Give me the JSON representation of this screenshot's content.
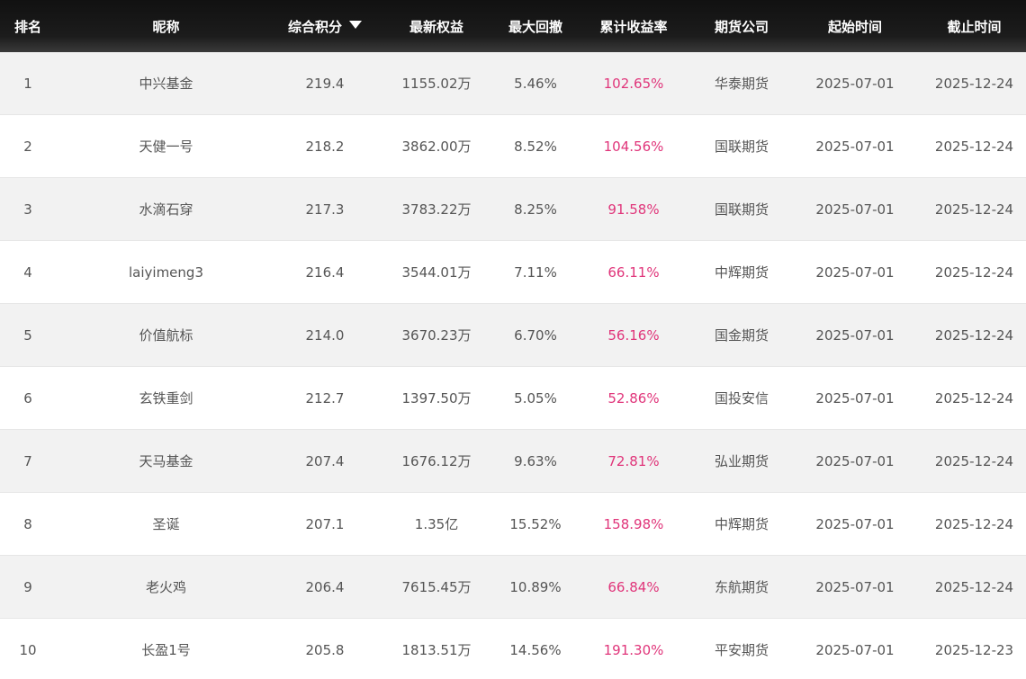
{
  "headers": {
    "rank": "排名",
    "nickname": "昵称",
    "score": "综合积分",
    "equity": "最新权益",
    "drawdown": "最大回撤",
    "return": "累计收益率",
    "company": "期货公司",
    "start": "起始时间",
    "end": "截止时间"
  },
  "sort": {
    "column": "score",
    "direction": "desc",
    "icon": "sort-down-icon"
  },
  "colors": {
    "header_bg": "#111111",
    "return_text": "#e0357a",
    "row_alt": "#f2f2f2"
  },
  "rows": [
    {
      "rank": "1",
      "nickname": "中兴基金",
      "score": "219.4",
      "equity": "1155.02万",
      "drawdown": "5.46%",
      "return": "102.65%",
      "company": "华泰期货",
      "start": "2025-07-01",
      "end": "2025-12-24"
    },
    {
      "rank": "2",
      "nickname": "天健一号",
      "score": "218.2",
      "equity": "3862.00万",
      "drawdown": "8.52%",
      "return": "104.56%",
      "company": "国联期货",
      "start": "2025-07-01",
      "end": "2025-12-24"
    },
    {
      "rank": "3",
      "nickname": "水滴石穿",
      "score": "217.3",
      "equity": "3783.22万",
      "drawdown": "8.25%",
      "return": "91.58%",
      "company": "国联期货",
      "start": "2025-07-01",
      "end": "2025-12-24"
    },
    {
      "rank": "4",
      "nickname": "laiyimeng3",
      "score": "216.4",
      "equity": "3544.01万",
      "drawdown": "7.11%",
      "return": "66.11%",
      "company": "中辉期货",
      "start": "2025-07-01",
      "end": "2025-12-24"
    },
    {
      "rank": "5",
      "nickname": "价值航标",
      "score": "214.0",
      "equity": "3670.23万",
      "drawdown": "6.70%",
      "return": "56.16%",
      "company": "国金期货",
      "start": "2025-07-01",
      "end": "2025-12-24"
    },
    {
      "rank": "6",
      "nickname": "玄铁重剑",
      "score": "212.7",
      "equity": "1397.50万",
      "drawdown": "5.05%",
      "return": "52.86%",
      "company": "国投安信",
      "start": "2025-07-01",
      "end": "2025-12-24"
    },
    {
      "rank": "7",
      "nickname": "天马基金",
      "score": "207.4",
      "equity": "1676.12万",
      "drawdown": "9.63%",
      "return": "72.81%",
      "company": "弘业期货",
      "start": "2025-07-01",
      "end": "2025-12-24"
    },
    {
      "rank": "8",
      "nickname": "圣诞",
      "score": "207.1",
      "equity": "1.35亿",
      "drawdown": "15.52%",
      "return": "158.98%",
      "company": "中辉期货",
      "start": "2025-07-01",
      "end": "2025-12-24"
    },
    {
      "rank": "9",
      "nickname": "老火鸡",
      "score": "206.4",
      "equity": "7615.45万",
      "drawdown": "10.89%",
      "return": "66.84%",
      "company": "东航期货",
      "start": "2025-07-01",
      "end": "2025-12-24"
    },
    {
      "rank": "10",
      "nickname": "长盈1号",
      "score": "205.8",
      "equity": "1813.51万",
      "drawdown": "14.56%",
      "return": "191.30%",
      "company": "平安期货",
      "start": "2025-07-01",
      "end": "2025-12-23"
    }
  ]
}
